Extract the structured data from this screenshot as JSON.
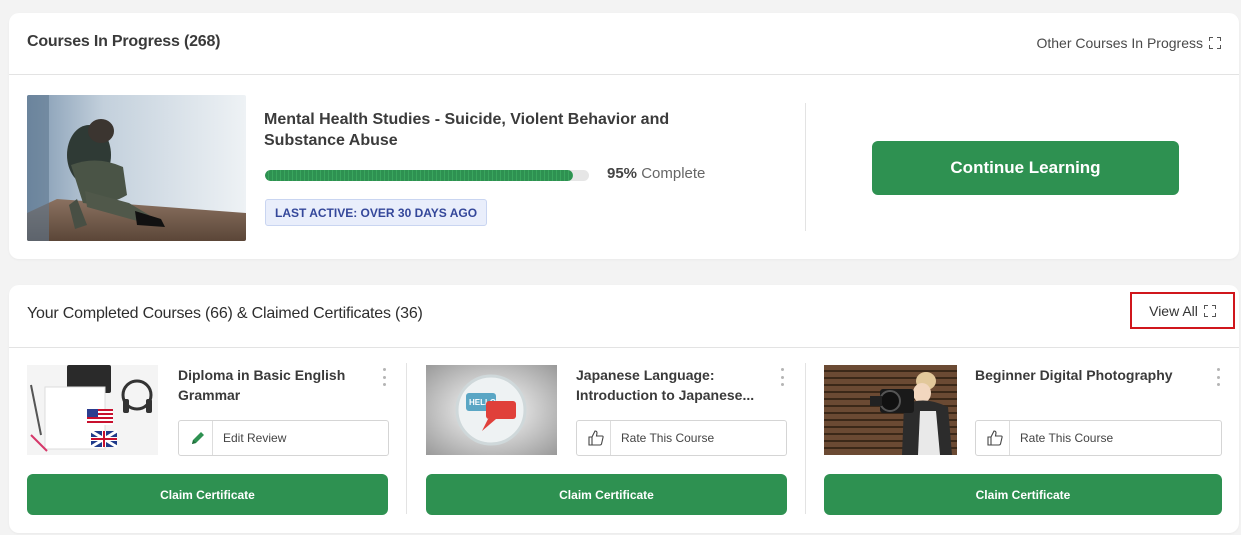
{
  "in_progress": {
    "title": "Courses In Progress (268)",
    "other_link": "Other Courses In Progress",
    "course": {
      "title": "Mental Health Studies - Suicide, Violent Behavior and Substance Abuse",
      "progress_percent": 95,
      "progress_value": "95%",
      "progress_suffix": "Complete",
      "last_active": "LAST ACTIVE: OVER 30 DAYS AGO",
      "continue_label": "Continue Learning"
    }
  },
  "completed": {
    "title": "Your Completed Courses (66) & Claimed Certificates (36)",
    "view_all": "View All",
    "courses": [
      {
        "title": "Diploma in Basic English Grammar",
        "action_label": "Edit Review",
        "action_icon": "pencil-icon",
        "claim_label": "Claim Certificate"
      },
      {
        "title": "Japanese Language: Introduction to Japanese...",
        "action_label": "Rate This Course",
        "action_icon": "thumbs-up-icon",
        "claim_label": "Claim Certificate"
      },
      {
        "title": "Beginner Digital Photography",
        "action_label": "Rate This Course",
        "action_icon": "thumbs-up-icon",
        "claim_label": "Claim Certificate"
      }
    ]
  },
  "colors": {
    "primary_green": "#2e9151",
    "highlight_red": "#d0161c",
    "badge_blue": "#34479a"
  }
}
